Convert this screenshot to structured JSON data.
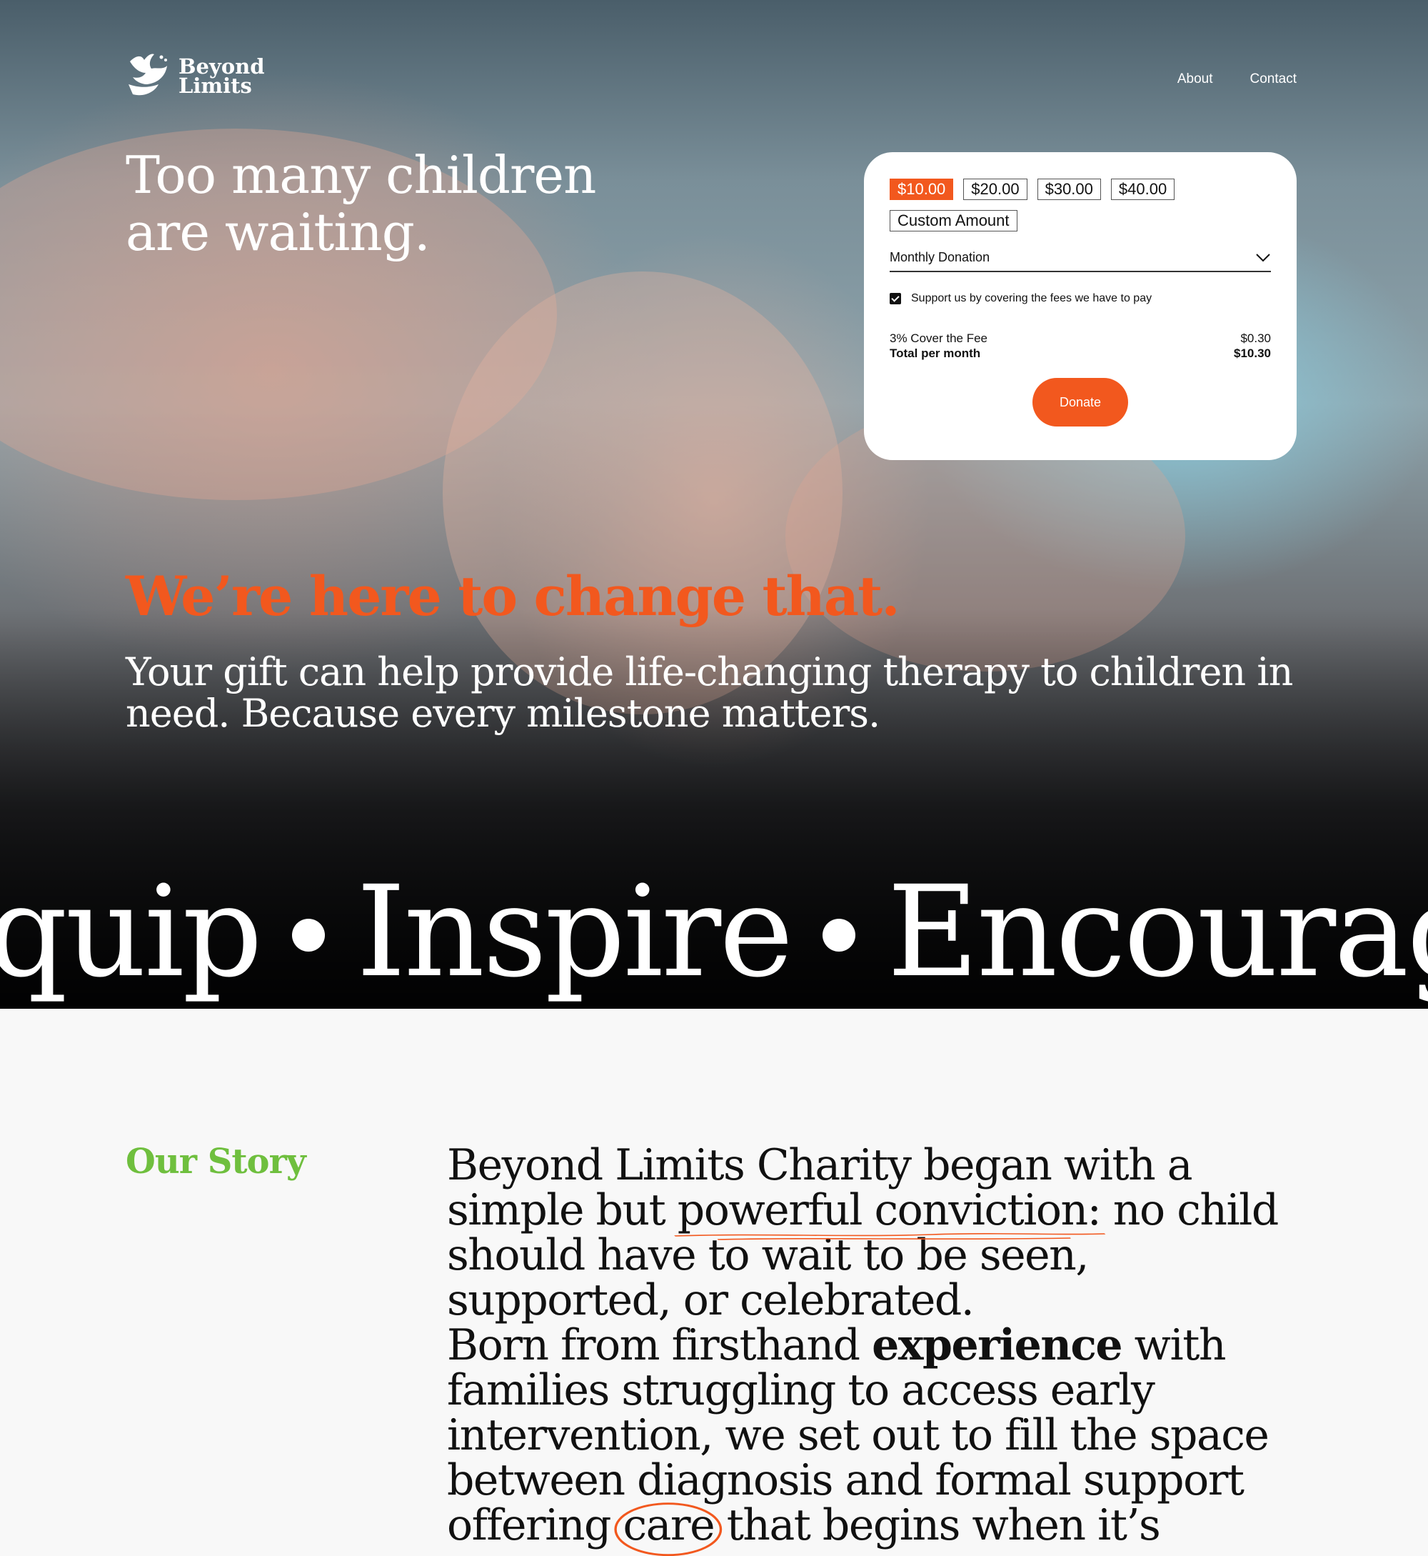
{
  "brand": {
    "name_line1": "Beyond",
    "name_line2": "Limits"
  },
  "nav": {
    "about": "About",
    "contact": "Contact"
  },
  "hero": {
    "headline_line1": "Too many children",
    "headline_line2": "are waiting.",
    "tagline": "We’re here to change that.",
    "subtext": "Your gift can help provide life-changing therapy to children in need. Because every milestone matters."
  },
  "donation": {
    "amounts": [
      "$10.00",
      "$20.00",
      "$30.00",
      "$40.00"
    ],
    "selected_amount": "$10.00",
    "custom_label": "Custom Amount",
    "frequency": "Monthly Donation",
    "cover_fees_label": "Support us by covering the fees we have to pay",
    "cover_fees_checked": true,
    "fee_label": "3% Cover the Fee",
    "fee_value": "$0.30",
    "total_label": "Total per month",
    "total_value": "$10.30",
    "donate_label": "Donate"
  },
  "marquee": {
    "word1": "quip",
    "word2": "Inspire",
    "word3": "Encourage"
  },
  "story": {
    "label": "Our Story",
    "p1_part1": "Beyond Limits Charity began with a simple but ",
    "p1_highlight": "powerful conviction",
    "p1_part2": ": no child should have to wait to be seen, supported, or celebrated.",
    "p2_part1": "Born from firsthand ",
    "p2_bold": "experience",
    "p2_part2": " with families struggling to access early intervention, we set out to fill the space between diagnosis and formal support offering ",
    "p2_circled": "care",
    "p2_part3": " that begins when it’s"
  },
  "colors": {
    "accent": "#f2581e",
    "story_label": "#6fbf3e",
    "text_dark": "#111111",
    "hero_text": "#ffffff"
  }
}
